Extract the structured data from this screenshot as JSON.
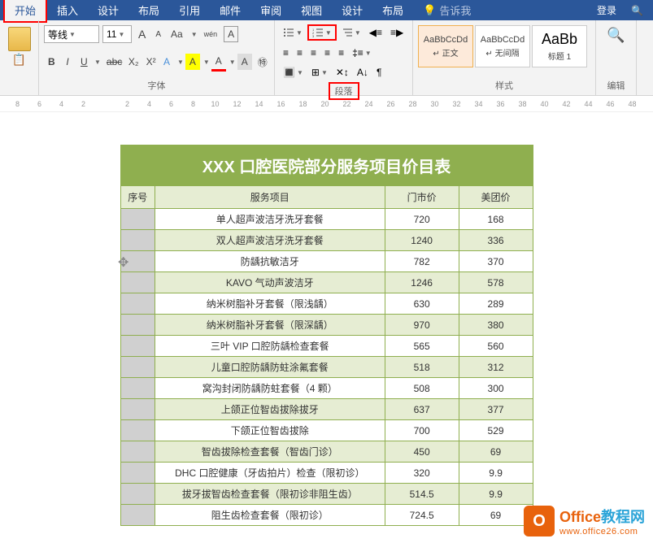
{
  "tabs": {
    "start": "开始",
    "insert": "插入",
    "design1": "设计",
    "layout1": "布局",
    "reference": "引用",
    "mail": "邮件",
    "review": "审阅",
    "view": "视图",
    "design2": "设计",
    "layout2": "布局",
    "tellme": "告诉我",
    "login": "登录"
  },
  "font": {
    "name": "等线",
    "size": "11",
    "group_label": "字体",
    "btns": {
      "grow": "A",
      "shrink": "A",
      "clear": "Aa",
      "phonetic": "wén",
      "bold": "B",
      "italic": "I",
      "underline": "U",
      "strike": "abc",
      "sub": "X₂",
      "sup": "X²",
      "effect": "A",
      "highlight": "A",
      "color": "A",
      "charfmt": "A",
      "circled": "㊕"
    }
  },
  "paragraph": {
    "group_label": "段落"
  },
  "styles": {
    "group_label": "样式",
    "items": [
      {
        "preview": "AaBbCcDd",
        "name": "↵ 正文"
      },
      {
        "preview": "AaBbCcDd",
        "name": "↵ 无间隔"
      },
      {
        "preview": "AaBb",
        "name": "标题 1"
      }
    ]
  },
  "edit": {
    "label": "编辑"
  },
  "ruler": [
    "8",
    "6",
    "4",
    "2",
    "",
    "2",
    "4",
    "6",
    "8",
    "10",
    "12",
    "14",
    "16",
    "18",
    "20",
    "22",
    "24",
    "26",
    "28",
    "30",
    "32",
    "34",
    "36",
    "38",
    "40",
    "42",
    "44",
    "46",
    "48"
  ],
  "table": {
    "title": "XXX 口腔医院部分服务项目价目表",
    "headers": {
      "num": "序号",
      "service": "服务项目",
      "retail": "门市价",
      "meituan": "美团价"
    },
    "rows": [
      {
        "service": "单人超声波洁牙洗牙套餐",
        "retail": "720",
        "meituan": "168"
      },
      {
        "service": "双人超声波洁牙洗牙套餐",
        "retail": "1240",
        "meituan": "336"
      },
      {
        "service": "防龋抗敏洁牙",
        "retail": "782",
        "meituan": "370"
      },
      {
        "service": "KAVO 气动声波洁牙",
        "retail": "1246",
        "meituan": "578"
      },
      {
        "service": "纳米树脂补牙套餐（限浅龋）",
        "retail": "630",
        "meituan": "289"
      },
      {
        "service": "纳米树脂补牙套餐（限深龋）",
        "retail": "970",
        "meituan": "380"
      },
      {
        "service": "三叶 VIP 口腔防龋检查套餐",
        "retail": "565",
        "meituan": "560"
      },
      {
        "service": "儿童口腔防龋防蛀涂氟套餐",
        "retail": "518",
        "meituan": "312"
      },
      {
        "service": "窝沟封闭防龋防蛀套餐（4 颗）",
        "retail": "508",
        "meituan": "300"
      },
      {
        "service": "上颌正位智齿拔除拔牙",
        "retail": "637",
        "meituan": "377"
      },
      {
        "service": "下颌正位智齿拔除",
        "retail": "700",
        "meituan": "529"
      },
      {
        "service": "智齿拔除检查套餐（智齿门诊）",
        "retail": "450",
        "meituan": "69"
      },
      {
        "service": "DHC 口腔健康（牙齿拍片）检查（限初诊）",
        "retail": "320",
        "meituan": "9.9"
      },
      {
        "service": "拔牙拔智齿检查套餐（限初诊非阻生齿）",
        "retail": "514.5",
        "meituan": "9.9"
      },
      {
        "service": "阻生齿检查套餐（限初诊）",
        "retail": "724.5",
        "meituan": "69"
      }
    ]
  },
  "watermark": {
    "brand1": "Office",
    "brand2": "教程网",
    "url": "www.office26.com"
  }
}
